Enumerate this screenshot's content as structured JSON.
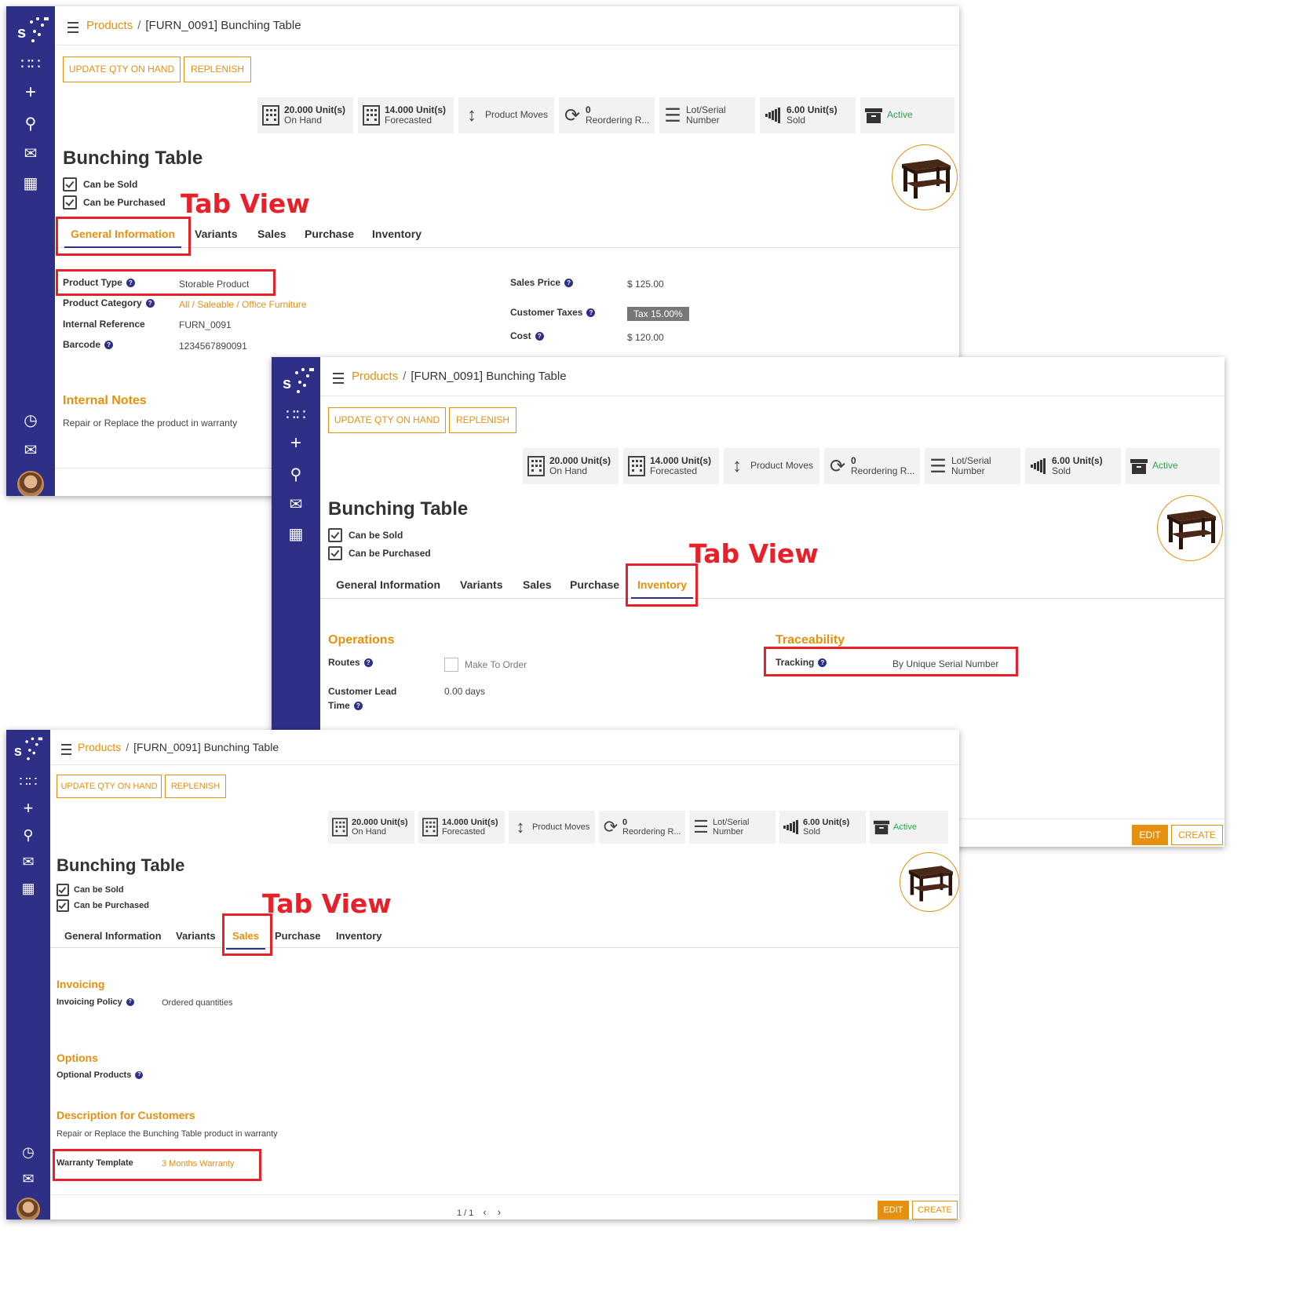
{
  "brand": {
    "accent": "#e6900f",
    "sidebar": "#2e3088",
    "annotation": "#e8202a",
    "active": "#28a745"
  },
  "breadcrumb": {
    "parent": "Products",
    "separator": "/",
    "current": "[FURN_0091] Bunching Table"
  },
  "actions": {
    "update_qty": "UPDATE QTY ON HAND",
    "replenish": "REPLENISH"
  },
  "stats": {
    "on_hand": {
      "value": "20.000 Unit(s)",
      "label": "On Hand",
      "icon": "building-icon"
    },
    "forecasted": {
      "value": "14.000 Unit(s)",
      "label": "Forecasted",
      "icon": "building-icon"
    },
    "moves": {
      "label": "Product Moves",
      "icon": "up-down-arrow-icon"
    },
    "reordering": {
      "value": "0",
      "label": "Reordering R...",
      "icon": "refresh-icon"
    },
    "lot_serial": {
      "value": "Lot/Serial",
      "label": "Number",
      "icon": "list-icon"
    },
    "sold": {
      "value": "6.00 Unit(s)",
      "label": "Sold",
      "icon": "signal-bars-icon"
    },
    "active": {
      "label": "Active",
      "icon": "archive-icon"
    }
  },
  "product": {
    "name": "Bunching Table",
    "can_be_sold": "Can be Sold",
    "can_be_purchased": "Can be Purchased"
  },
  "tabs": {
    "general": "General Information",
    "variants": "Variants",
    "sales": "Sales",
    "purchase": "Purchase",
    "inventory": "Inventory"
  },
  "annotation": {
    "tab_view": "Tab View"
  },
  "general": {
    "product_type_label": "Product Type",
    "product_type": "Storable Product",
    "category_label": "Product Category",
    "category": "All / Saleable / Office Furniture",
    "internal_ref_label": "Internal Reference",
    "internal_ref": "FURN_0091",
    "barcode_label": "Barcode",
    "barcode": "1234567890091",
    "sales_price_label": "Sales Price",
    "sales_price": "$ 125.00",
    "customer_taxes_label": "Customer Taxes",
    "customer_taxes": "Tax 15.00%",
    "cost_label": "Cost",
    "cost": "$ 120.00",
    "internal_notes_title": "Internal Notes",
    "internal_notes": "Repair or Replace the product in warranty"
  },
  "inventory": {
    "operations_title": "Operations",
    "routes_label": "Routes",
    "route_option": "Make To Order",
    "lead_time_label_1": "Customer Lead",
    "lead_time_label_2": "Time",
    "lead_time": "0.00 days",
    "traceability_title": "Traceability",
    "tracking_label": "Tracking",
    "tracking": "By Unique Serial Number"
  },
  "sales": {
    "invoicing_title": "Invoicing",
    "invoicing_policy_label": "Invoicing Policy",
    "invoicing_policy": "Ordered quantities",
    "options_title": "Options",
    "optional_products_label": "Optional Products",
    "desc_title": "Description for Customers",
    "description": "Repair or Replace the Bunching Table product in warranty",
    "warranty_label": "Warranty Template",
    "warranty": "3 Months Warranty"
  },
  "footer": {
    "edit": "EDIT",
    "create": "CREATE",
    "pager": "1 / 1"
  },
  "help_glyph": "?"
}
